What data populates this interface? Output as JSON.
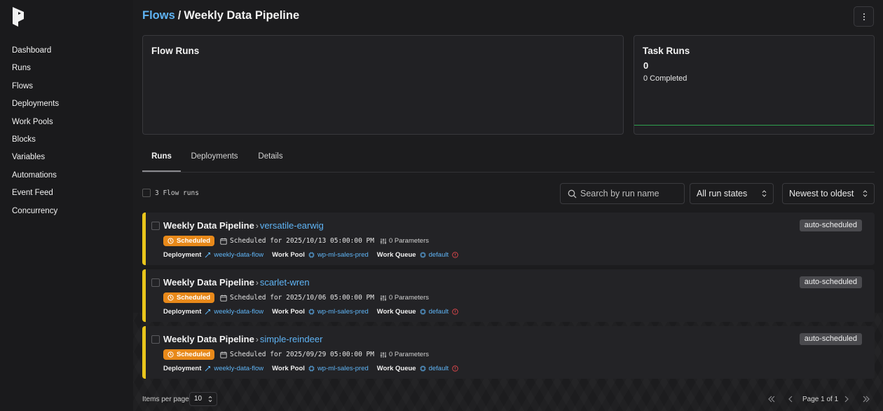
{
  "breadcrumb": {
    "parent": "Flows",
    "separator": "/",
    "current": "Weekly Data Pipeline"
  },
  "sidebar": {
    "items": [
      {
        "label": "Dashboard"
      },
      {
        "label": "Runs"
      },
      {
        "label": "Flows"
      },
      {
        "label": "Deployments"
      },
      {
        "label": "Work Pools"
      },
      {
        "label": "Blocks"
      },
      {
        "label": "Variables"
      },
      {
        "label": "Automations"
      },
      {
        "label": "Event Feed"
      },
      {
        "label": "Concurrency"
      }
    ]
  },
  "cards": {
    "flow_runs": {
      "title": "Flow Runs"
    },
    "task_runs": {
      "title": "Task Runs",
      "count": "0",
      "completed": "0 Completed",
      "line_color": "#2fa14f"
    }
  },
  "tabs": [
    {
      "label": "Runs",
      "active": true
    },
    {
      "label": "Deployments",
      "active": false
    },
    {
      "label": "Details",
      "active": false
    }
  ],
  "toolbar": {
    "runs_count": "3 Flow runs",
    "search_placeholder": "Search by run name",
    "state_filter": "All run states",
    "sort": "Newest to oldest"
  },
  "runs": [
    {
      "flow": "Weekly Data Pipeline",
      "name": "versatile-earwig",
      "tag": "auto-scheduled",
      "state": "Scheduled",
      "scheduled": "Scheduled for 2025/10/13 05:00:00 PM",
      "parameters": "0 Parameters",
      "deployment_label": "Deployment",
      "deployment": "weekly-data-flow",
      "work_pool_label": "Work Pool",
      "work_pool": "wp-ml-sales-pred",
      "work_queue_label": "Work Queue",
      "work_queue": "default"
    },
    {
      "flow": "Weekly Data Pipeline",
      "name": "scarlet-wren",
      "tag": "auto-scheduled",
      "state": "Scheduled",
      "scheduled": "Scheduled for 2025/10/06 05:00:00 PM",
      "parameters": "0 Parameters",
      "deployment_label": "Deployment",
      "deployment": "weekly-data-flow",
      "work_pool_label": "Work Pool",
      "work_pool": "wp-ml-sales-pred",
      "work_queue_label": "Work Queue",
      "work_queue": "default"
    },
    {
      "flow": "Weekly Data Pipeline",
      "name": "simple-reindeer",
      "tag": "auto-scheduled",
      "state": "Scheduled",
      "scheduled": "Scheduled for 2025/09/29 05:00:00 PM",
      "parameters": "0 Parameters",
      "deployment_label": "Deployment",
      "deployment": "weekly-data-flow",
      "work_pool_label": "Work Pool",
      "work_pool": "wp-ml-sales-pred",
      "work_queue_label": "Work Queue",
      "work_queue": "default"
    }
  ],
  "colors": {
    "accent_link": "#5fb4f5",
    "scheduled": "#e8891a",
    "run_stripe": "#e9c51c",
    "warning": "#e5484d"
  },
  "pagination": {
    "items_per_page_label": "Items per page",
    "items_per_page": "10",
    "page_text": "Page 1 of 1"
  }
}
